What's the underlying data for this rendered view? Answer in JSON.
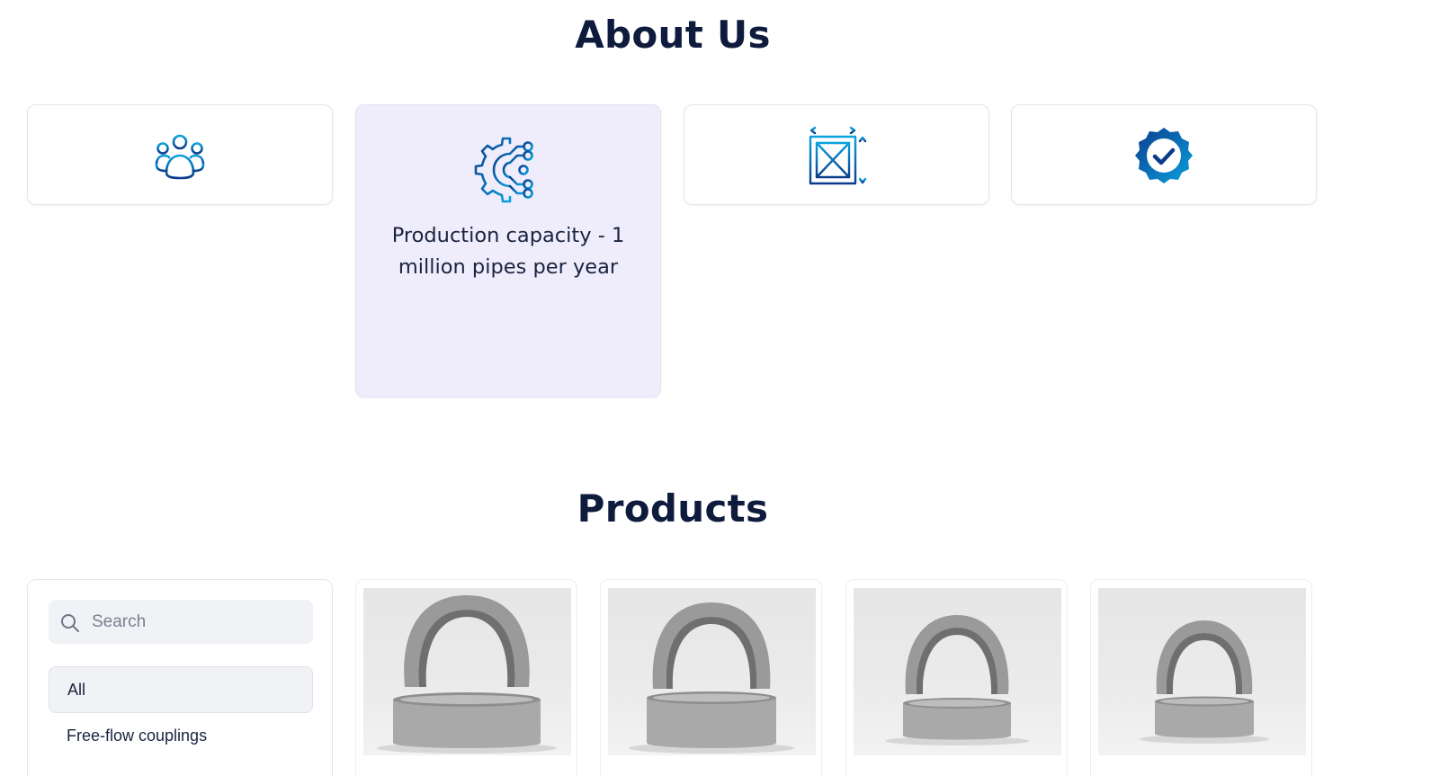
{
  "about": {
    "title": "About Us",
    "features": [
      {
        "icon": "team-icon",
        "text": ""
      },
      {
        "icon": "gear-network-icon",
        "text": "Production capacity - 1 million pipes per year",
        "active": true
      },
      {
        "icon": "dimensions-icon",
        "text": ""
      },
      {
        "icon": "verified-badge-icon",
        "text": ""
      }
    ]
  },
  "products": {
    "title": "Products",
    "search": {
      "placeholder": "Search",
      "value": ""
    },
    "filters": [
      {
        "label": "All",
        "selected": true
      },
      {
        "label": "Free-flow couplings",
        "selected": false
      }
    ],
    "items": [
      {
        "image": "concrete-ring-product-image"
      },
      {
        "image": "concrete-ring-product-image"
      },
      {
        "image": "concrete-ring-product-image"
      },
      {
        "image": "concrete-ring-product-image"
      }
    ]
  },
  "colors": {
    "heading": "#0f1b3d",
    "icon_gradient_start": "#0aa2e0",
    "icon_gradient_end": "#0b3c8c",
    "active_card_bg": "#efedfb"
  }
}
